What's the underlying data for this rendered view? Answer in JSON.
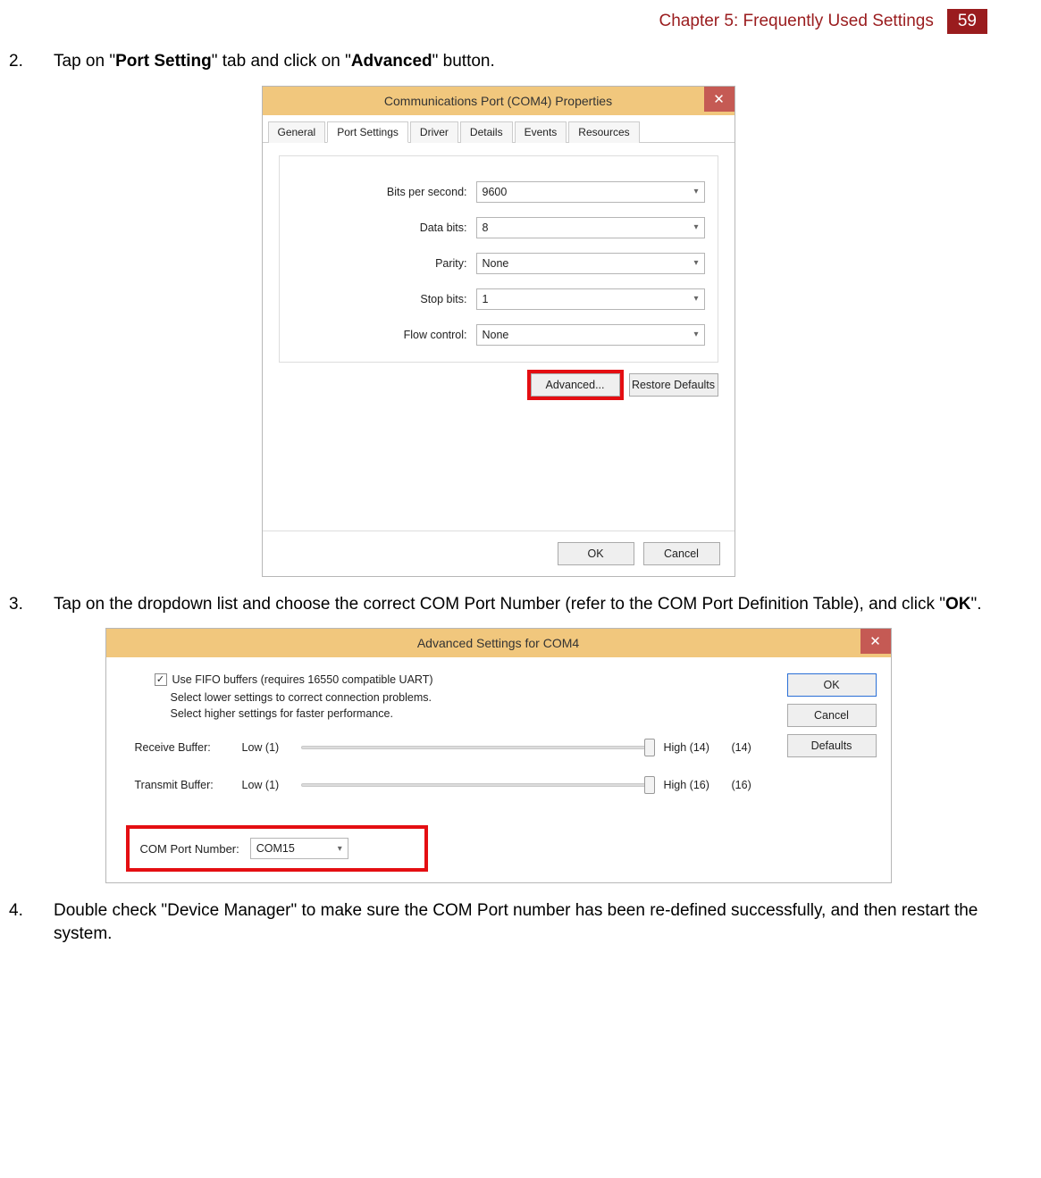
{
  "header": {
    "chapter": "Chapter 5: Frequently Used Settings",
    "page": "59"
  },
  "steps": {
    "s2": {
      "num": "2.",
      "pre": "Tap on \"",
      "b1": "Port Setting",
      "mid": "\" tab and click on \"",
      "b2": "Advanced",
      "post": "\" button."
    },
    "s3": {
      "num": "3.",
      "pre": "Tap on the dropdown list and choose the correct COM Port Number (refer to the COM Port Definition Table), and click \"",
      "b1": "OK",
      "post": "\"."
    },
    "s4": {
      "num": "4.",
      "text": "Double check \"Device Manager\" to make sure the COM Port number has been re-defined successfully, and then restart the system."
    }
  },
  "dialog1": {
    "title": "Communications Port (COM4) Properties",
    "close": "✕",
    "tabs": [
      "General",
      "Port Settings",
      "Driver",
      "Details",
      "Events",
      "Resources"
    ],
    "fields": {
      "bps": {
        "label": "Bits per second:",
        "value": "9600"
      },
      "data": {
        "label": "Data bits:",
        "value": "8"
      },
      "parity": {
        "label": "Parity:",
        "value": "None"
      },
      "stop": {
        "label": "Stop bits:",
        "value": "1"
      },
      "flow": {
        "label": "Flow control:",
        "value": "None"
      }
    },
    "advanced": "Advanced...",
    "restore": "Restore Defaults",
    "ok": "OK",
    "cancel": "Cancel"
  },
  "dialog2": {
    "title": "Advanced Settings for COM4",
    "close": "✕",
    "fifo_check": "✓",
    "fifo_label": "Use FIFO buffers (requires 16550 compatible UART)",
    "hint1": "Select lower settings to correct connection problems.",
    "hint2": "Select higher settings for faster performance.",
    "recv": {
      "label": "Receive Buffer:",
      "low": "Low (1)",
      "high": "High (14)",
      "val": "(14)"
    },
    "xmit": {
      "label": "Transmit Buffer:",
      "low": "Low (1)",
      "high": "High (16)",
      "val": "(16)"
    },
    "port_label": "COM Port Number:",
    "port_value": "COM15",
    "ok": "OK",
    "cancel": "Cancel",
    "defaults": "Defaults"
  }
}
